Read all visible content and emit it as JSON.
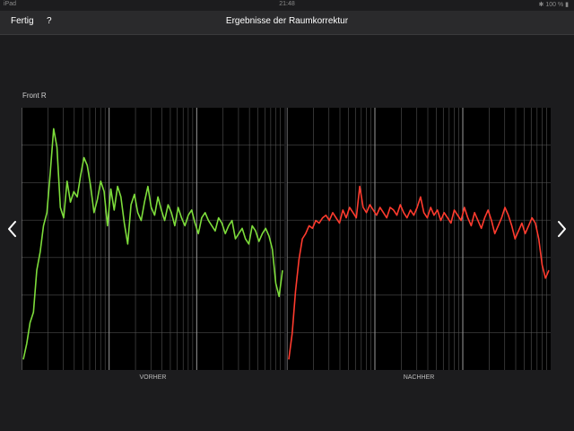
{
  "status_bar": {
    "carrier": "iPad",
    "time": "21:48",
    "battery": "100 %"
  },
  "nav": {
    "done_label": "Fertig",
    "help_label": "?",
    "title": "Ergebnisse der Raumkorrektur"
  },
  "channel": "Front R",
  "icons": {
    "prev": "chevron-left-icon",
    "next": "chevron-right-icon",
    "wifi": "wifi-icon",
    "bluetooth": "bluetooth-icon",
    "battery": "battery-icon"
  },
  "colors": {
    "background": "#1c1c1e",
    "before_curve": "#7ddc3b",
    "after_curve": "#ff3b2e",
    "grid": "#5a5a5a"
  },
  "chart_data": [
    {
      "type": "line",
      "title": "",
      "xlabel": "VORHER",
      "ylabel": "",
      "color": "#7ddc3b",
      "x_scale": "log",
      "grid": true,
      "series": [
        {
          "values": [
            0.04,
            0.1,
            0.18,
            0.22,
            0.38,
            0.45,
            0.55,
            0.6,
            0.75,
            0.92,
            0.85,
            0.62,
            0.58,
            0.72,
            0.64,
            0.68,
            0.66,
            0.74,
            0.81,
            0.78,
            0.7,
            0.6,
            0.65,
            0.72,
            0.68,
            0.55,
            0.69,
            0.61,
            0.7,
            0.66,
            0.56,
            0.48,
            0.63,
            0.67,
            0.6,
            0.57,
            0.64,
            0.7,
            0.62,
            0.59,
            0.66,
            0.61,
            0.57,
            0.63,
            0.6,
            0.55,
            0.62,
            0.58,
            0.55,
            0.59,
            0.61,
            0.56,
            0.52,
            0.58,
            0.6,
            0.57,
            0.55,
            0.53,
            0.58,
            0.56,
            0.52,
            0.55,
            0.57,
            0.5,
            0.52,
            0.54,
            0.5,
            0.48,
            0.55,
            0.53,
            0.49,
            0.52,
            0.54,
            0.51,
            0.46,
            0.33,
            0.28,
            0.38
          ]
        }
      ]
    },
    {
      "type": "line",
      "title": "",
      "xlabel": "NACHHER",
      "ylabel": "",
      "color": "#ff3b2e",
      "x_scale": "log",
      "grid": true,
      "series": [
        {
          "values": [
            0.04,
            0.14,
            0.3,
            0.42,
            0.5,
            0.52,
            0.55,
            0.54,
            0.57,
            0.56,
            0.58,
            0.59,
            0.57,
            0.6,
            0.58,
            0.56,
            0.61,
            0.58,
            0.62,
            0.6,
            0.58,
            0.7,
            0.62,
            0.6,
            0.63,
            0.61,
            0.59,
            0.62,
            0.6,
            0.58,
            0.62,
            0.61,
            0.59,
            0.63,
            0.6,
            0.58,
            0.61,
            0.59,
            0.62,
            0.66,
            0.6,
            0.58,
            0.62,
            0.59,
            0.61,
            0.57,
            0.6,
            0.58,
            0.56,
            0.61,
            0.59,
            0.57,
            0.62,
            0.58,
            0.55,
            0.6,
            0.57,
            0.54,
            0.58,
            0.61,
            0.57,
            0.52,
            0.55,
            0.58,
            0.62,
            0.59,
            0.55,
            0.5,
            0.53,
            0.56,
            0.52,
            0.55,
            0.58,
            0.56,
            0.5,
            0.4,
            0.35,
            0.38
          ]
        }
      ]
    }
  ]
}
